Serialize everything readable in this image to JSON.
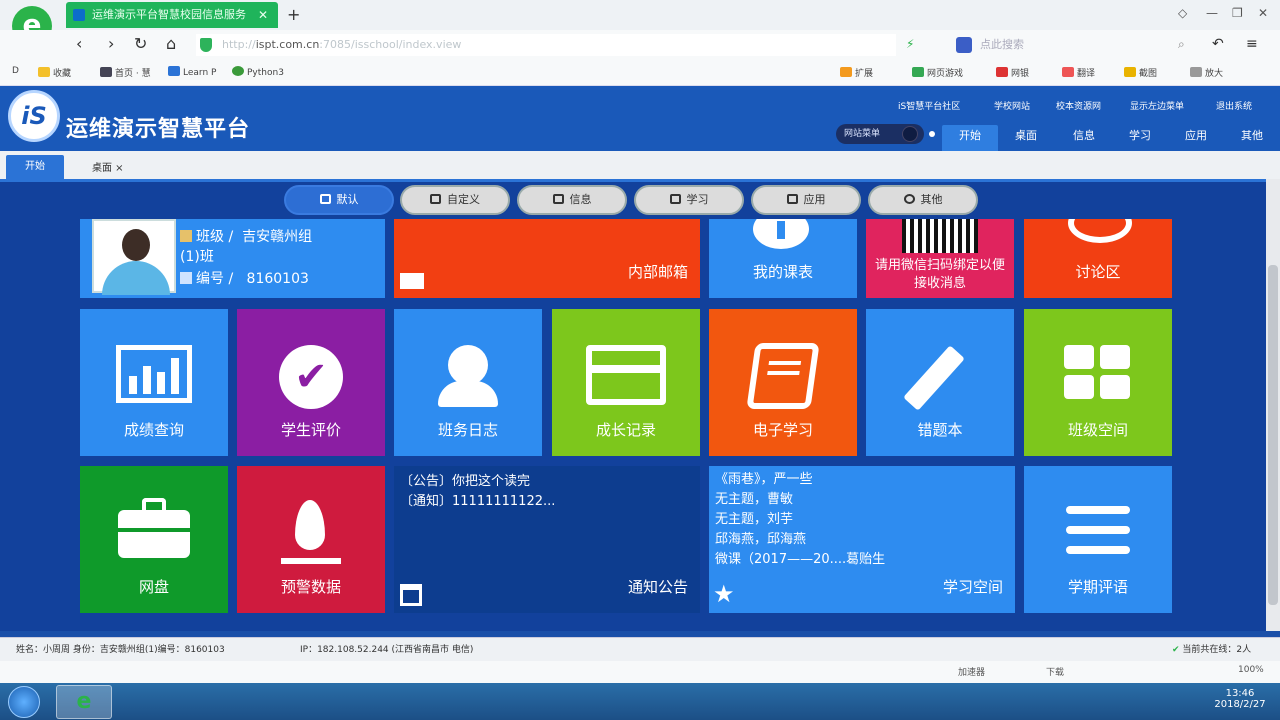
{
  "browser": {
    "tab_title": "运维演示平台智慧校园信息服务",
    "url_prefix": "http://",
    "url_host": "ispt.com.cn",
    "url_path": ":7085/isschool/index.view",
    "search_placeholder": "点此搜索",
    "bookmarks": [
      "收藏",
      "首页 · 慧",
      "Learn P",
      "Python3"
    ],
    "toolbar_right": [
      "扩展",
      "网页游戏",
      "网银",
      "翻译",
      "截图",
      "放大"
    ]
  },
  "site": {
    "logo_text": "iS",
    "title": "运维演示智慧平台",
    "top_links": [
      "iS智慧平台社区",
      "学校网站",
      "校本资源网",
      "显示左边菜单",
      "退出系统"
    ],
    "switch_label": "网站菜单",
    "nav": [
      "开始",
      "桌面",
      "信息",
      "学习",
      "应用",
      "其他"
    ],
    "page_tabs": [
      "开始",
      "桌面"
    ]
  },
  "pills": [
    "默认",
    "自定义",
    "信息",
    "学习",
    "应用",
    "其他"
  ],
  "profile": {
    "class_key": "班级",
    "class_value": "吉安赣州组",
    "class_value2": "(1)班",
    "id_key": "编号",
    "id_value": "8160103"
  },
  "tiles": {
    "mail": "内部邮箱",
    "schedule": "我的课表",
    "wechat": "请用微信扫码绑定以便接收消息",
    "forum": "讨论区",
    "scores": "成绩查询",
    "evaluation": "学生评价",
    "duty_log": "班务日志",
    "growth": "成长记录",
    "ebook": "电子学习",
    "mistakes": "错题本",
    "class_space": "班级空间",
    "netdisk": "网盘",
    "warning": "预警数据",
    "notice": "通知公告",
    "study_space": "学习空间",
    "term_review": "学期评语"
  },
  "notices": [
    "〔公告〕你把这个读完",
    "〔通知〕11111111122..."
  ],
  "study_items": [
    "《雨巷》，严一些",
    "无主题，曹敏",
    "无主题，刘芋",
    "邱海燕，邱海燕",
    "微课（2017——20....葛贻生"
  ],
  "status": {
    "left": "姓名：小周周  身份：吉安赣州组(1)编号：8160103",
    "ip": "IP：182.108.52.244 (江西省南昌市 电信)",
    "online": "当前共在线：2人"
  },
  "browser_status": [
    "加速器",
    "下载",
    "100%"
  ],
  "taskbar": {
    "time": "13:46",
    "date": "2018/2/27"
  }
}
